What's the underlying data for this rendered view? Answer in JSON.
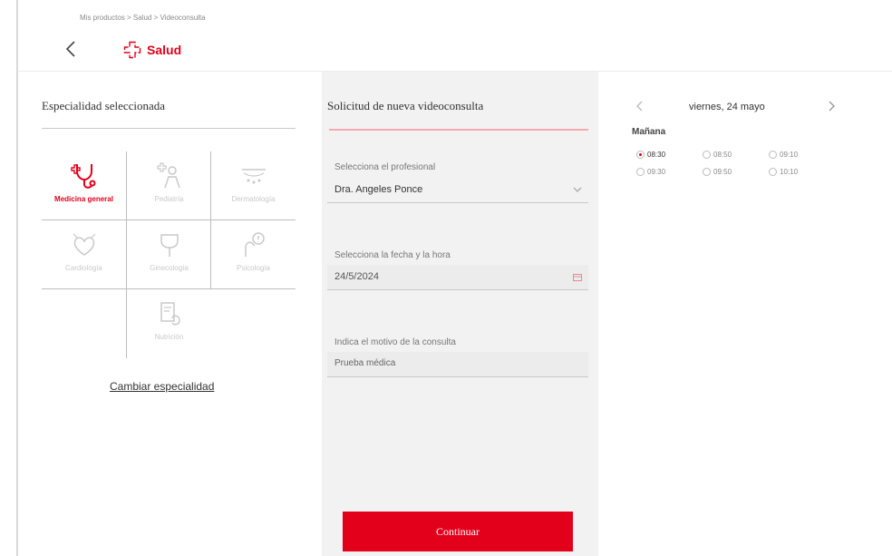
{
  "header": {
    "breadcrumb": "Mis productos > Salud > Videoconsulta",
    "title": "Salud"
  },
  "specialty": {
    "title": "Especialidad seleccionada",
    "items": [
      {
        "label": "Medicina general",
        "icon": "stethoscope-icon",
        "active": true
      },
      {
        "label": "Pediatría",
        "icon": "pediatrics-icon",
        "active": false
      },
      {
        "label": "Dermatología",
        "icon": "dermatology-icon",
        "active": false
      },
      {
        "label": "Cardiología",
        "icon": "cardiology-icon",
        "active": false
      },
      {
        "label": "Ginecología",
        "icon": "gynecology-icon",
        "active": false
      },
      {
        "label": "Psicología",
        "icon": "psychology-icon",
        "active": false
      },
      {
        "label": "Nutrición",
        "icon": "nutrition-icon",
        "active": false
      }
    ],
    "change_link": "Cambiar especialidad"
  },
  "request": {
    "title": "Solicitud de nueva videoconsulta",
    "professional_label": "Selecciona el profesional",
    "professional_value": "Dra. Angeles Ponce",
    "datetime_label": "Selecciona la fecha y la hora",
    "date_value": "24/5/2024",
    "reason_label": "Indica el motivo de la consulta",
    "reason_value": "Prueba médica",
    "continue_label": "Continuar"
  },
  "schedule": {
    "date_label": "viernes, 24 mayo",
    "period": "Mañana",
    "slots": [
      {
        "time": "08:30",
        "selected": true
      },
      {
        "time": "08:50",
        "selected": false
      },
      {
        "time": "09:10",
        "selected": false
      },
      {
        "time": "09:30",
        "selected": false
      },
      {
        "time": "09:50",
        "selected": false
      },
      {
        "time": "10:10",
        "selected": false
      }
    ]
  },
  "colors": {
    "accent": "#e3001b"
  }
}
